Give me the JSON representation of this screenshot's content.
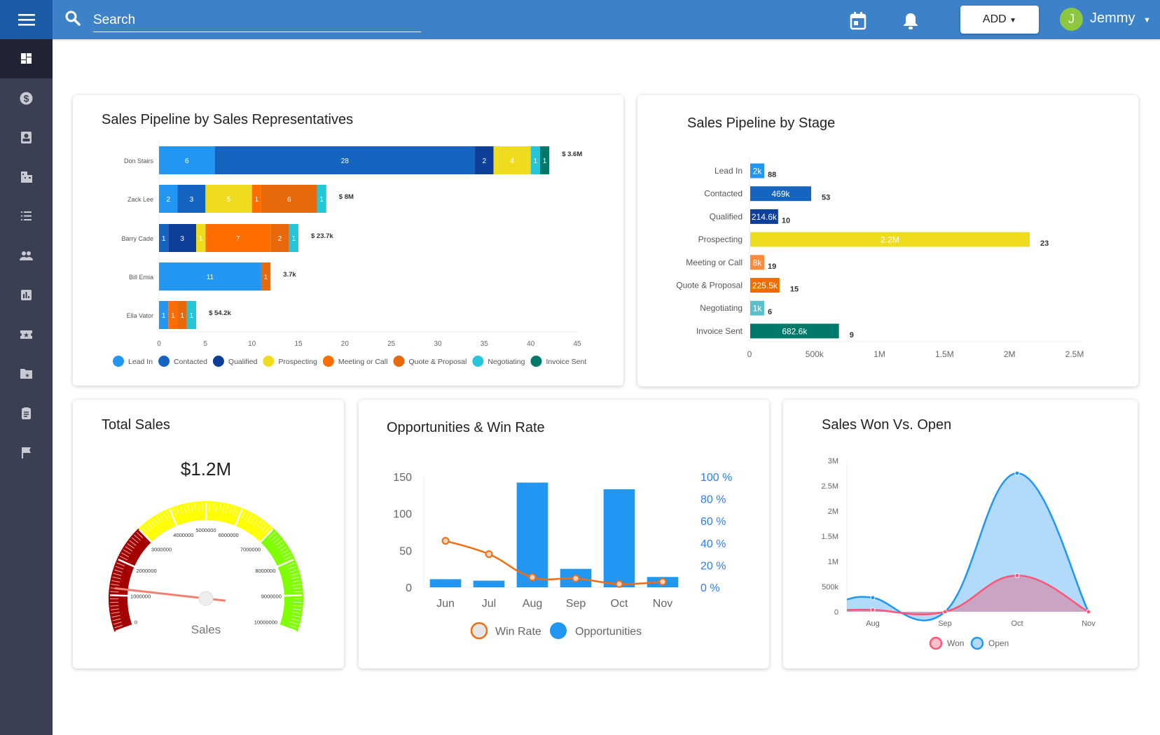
{
  "topbar": {
    "search_placeholder": "Search",
    "add_label": "ADD",
    "user_initial": "J",
    "user_name": "Jemmy",
    "color": "#3d82c8"
  },
  "sidebar": {
    "items": [
      {
        "icon": "dashboard-icon",
        "active": true
      },
      {
        "icon": "dollar-icon"
      },
      {
        "icon": "contact-card-icon"
      },
      {
        "icon": "building-icon"
      },
      {
        "icon": "list-icon"
      },
      {
        "icon": "people-icon"
      },
      {
        "icon": "bar-chart-icon"
      },
      {
        "icon": "ticket-star-icon"
      },
      {
        "icon": "folder-star-icon"
      },
      {
        "icon": "clipboard-icon"
      },
      {
        "icon": "flag-icon"
      }
    ]
  },
  "stage_colors": {
    "Lead In": "#2196f3",
    "Contacted": "#1565c0",
    "Qualified": "#0d3f9a",
    "Prospecting": "#f0dc1e",
    "Meeting or Call": "#ff6d00",
    "Quote & Proposal": "#e8690a",
    "Negotiating": "#26c6da",
    "Invoice Sent": "#00796b"
  },
  "chart_data": [
    {
      "id": "reps",
      "type": "bar",
      "orientation": "horizontal",
      "stacked": true,
      "title": "Sales Pipeline by Sales Representatives",
      "xlim": [
        0,
        45
      ],
      "xticks": [
        0,
        5,
        10,
        15,
        20,
        25,
        30,
        35,
        40,
        45
      ],
      "legend": "bottom",
      "categories": [
        "Don Stairs",
        "Zack Lee",
        "Barry Cade",
        "Bill Emia",
        "Ella Vator"
      ],
      "totals": [
        "$ 3.6M",
        "$ 8M",
        "$ 23.7k",
        "3.7k",
        "$ 54.2k"
      ],
      "series": [
        {
          "name": "Lead In",
          "values": [
            6,
            2,
            0,
            11,
            1
          ]
        },
        {
          "name": "Contacted",
          "values": [
            28,
            3,
            1,
            0,
            0
          ]
        },
        {
          "name": "Qualified",
          "values": [
            2,
            0,
            3,
            0,
            0
          ]
        },
        {
          "name": "Prospecting",
          "values": [
            4,
            5,
            1,
            0,
            0
          ]
        },
        {
          "name": "Meeting or Call",
          "values": [
            0,
            1,
            7,
            0,
            1
          ]
        },
        {
          "name": "Quote & Proposal",
          "values": [
            0,
            6,
            2,
            1,
            1
          ]
        },
        {
          "name": "Negotiating",
          "values": [
            1,
            1,
            1,
            0,
            1
          ]
        },
        {
          "name": "Invoice Sent",
          "values": [
            1,
            0,
            0,
            0,
            0
          ]
        }
      ]
    },
    {
      "id": "stage",
      "type": "bar",
      "orientation": "horizontal",
      "title": "Sales Pipeline by Stage",
      "xlim": [
        0,
        2500000
      ],
      "xticks": [
        0,
        500000,
        1000000,
        1500000,
        2000000,
        2500000
      ],
      "xtick_labels": [
        "0",
        "500k",
        "1M",
        "1.5M",
        "2M",
        "2.5M"
      ],
      "categories": [
        "Lead In",
        "Contacted",
        "Qualified",
        "Prospecting",
        "Meeting or Call",
        "Quote & Proposal",
        "Negotiating",
        "Invoice Sent"
      ],
      "values": [
        2000,
        469000,
        214600,
        2150000,
        8000,
        225500,
        1000,
        682600
      ],
      "value_labels": [
        "2k",
        "469k",
        "214.6k",
        "2.2M",
        "8k",
        "225.5k",
        "1k",
        "682.6k"
      ],
      "counts": [
        88,
        53,
        10,
        23,
        19,
        15,
        6,
        9
      ],
      "colors": [
        "#2196f3",
        "#1565c0",
        "#0d3f9a",
        "#f0dc1e",
        "#ff8a3d",
        "#ef6c00",
        "#5bc0cc",
        "#00796b"
      ]
    },
    {
      "id": "gauge",
      "type": "gauge",
      "title": "Total Sales",
      "value_label": "$1.2M",
      "value": 1200000,
      "min": 0,
      "max": 10000000,
      "label": "Sales",
      "tick_labels": [
        "0",
        "1000000",
        "2000000",
        "3000000",
        "4000000",
        "5000000",
        "6000000",
        "7000000",
        "8000000",
        "9000000",
        "10000000"
      ],
      "bands": [
        {
          "from": 0,
          "to": 3000000,
          "color": "#a50000"
        },
        {
          "from": 3000000,
          "to": 7000000,
          "color": "#ffff00"
        },
        {
          "from": 7000000,
          "to": 10000000,
          "color": "#7fff00"
        }
      ]
    },
    {
      "id": "opps",
      "type": "bar+line",
      "title": "Opportunities & Win Rate",
      "categories": [
        "Jun",
        "Jul",
        "Aug",
        "Sep",
        "Oct",
        "Nov"
      ],
      "ylim": [
        0,
        150
      ],
      "yticks": [
        0,
        50,
        100,
        150
      ],
      "y2lim": [
        0,
        100
      ],
      "y2ticks": [
        "0 %",
        "20 %",
        "40 %",
        "60 %",
        "80 %",
        "100 %"
      ],
      "legend": "bottom",
      "series": [
        {
          "name": "Win Rate",
          "type": "line",
          "axis": "right",
          "values": [
            42,
            30,
            9,
            8,
            3,
            5
          ],
          "color": "#f26d0f"
        },
        {
          "name": "Opportunities",
          "type": "bar",
          "axis": "left",
          "values": [
            11,
            9,
            142,
            25,
            133,
            14
          ],
          "color": "#2196f3"
        }
      ]
    },
    {
      "id": "wonopen",
      "type": "area",
      "title": "Sales Won Vs. Open",
      "categories": [
        "Aug",
        "Sep",
        "Oct",
        "Nov"
      ],
      "ylim": [
        0,
        3000000
      ],
      "yticks": [
        "0",
        "500k",
        "1M",
        "1.5M",
        "2M",
        "2.5M",
        "3M"
      ],
      "legend": "bottom",
      "series": [
        {
          "name": "Won",
          "values": [
            40000,
            0,
            720000,
            0
          ],
          "color": "#ff5577"
        },
        {
          "name": "Open",
          "values": [
            280000,
            0,
            2750000,
            0
          ],
          "color": "#2196f3"
        }
      ]
    }
  ]
}
